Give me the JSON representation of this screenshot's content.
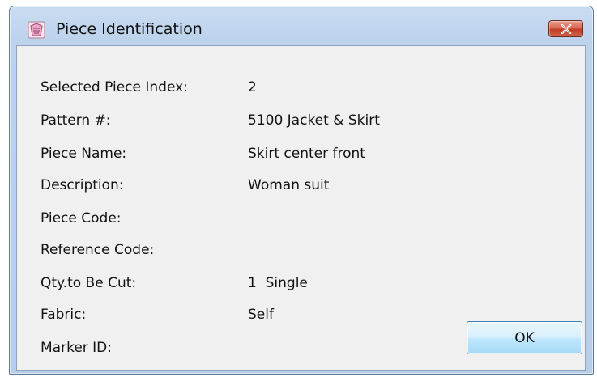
{
  "window": {
    "title": "Piece Identification",
    "icon": "pattern-piece-icon",
    "close_icon": "close-icon"
  },
  "fields": [
    {
      "label": "Selected Piece Index:",
      "value": "2"
    },
    {
      "label": "Pattern #:",
      "value": "5100 Jacket & Skirt"
    },
    {
      "label": "Piece Name:",
      "value": "Skirt center front"
    },
    {
      "label": "Description:",
      "value": "Woman suit"
    },
    {
      "label": "Piece Code:",
      "value": ""
    },
    {
      "label": "Reference Code:",
      "value": ""
    },
    {
      "label": "Qty.to Be Cut:",
      "value": "1  Single"
    },
    {
      "label": "Fabric:",
      "value": "Self"
    },
    {
      "label": "Marker ID:",
      "value": ""
    }
  ],
  "buttons": {
    "ok_label": "OK"
  },
  "colors": {
    "titlebar": "#bdd3ec",
    "client": "#f0f0f0",
    "close_button": "#c23c25",
    "ok_button_border": "#3c7fb1"
  }
}
